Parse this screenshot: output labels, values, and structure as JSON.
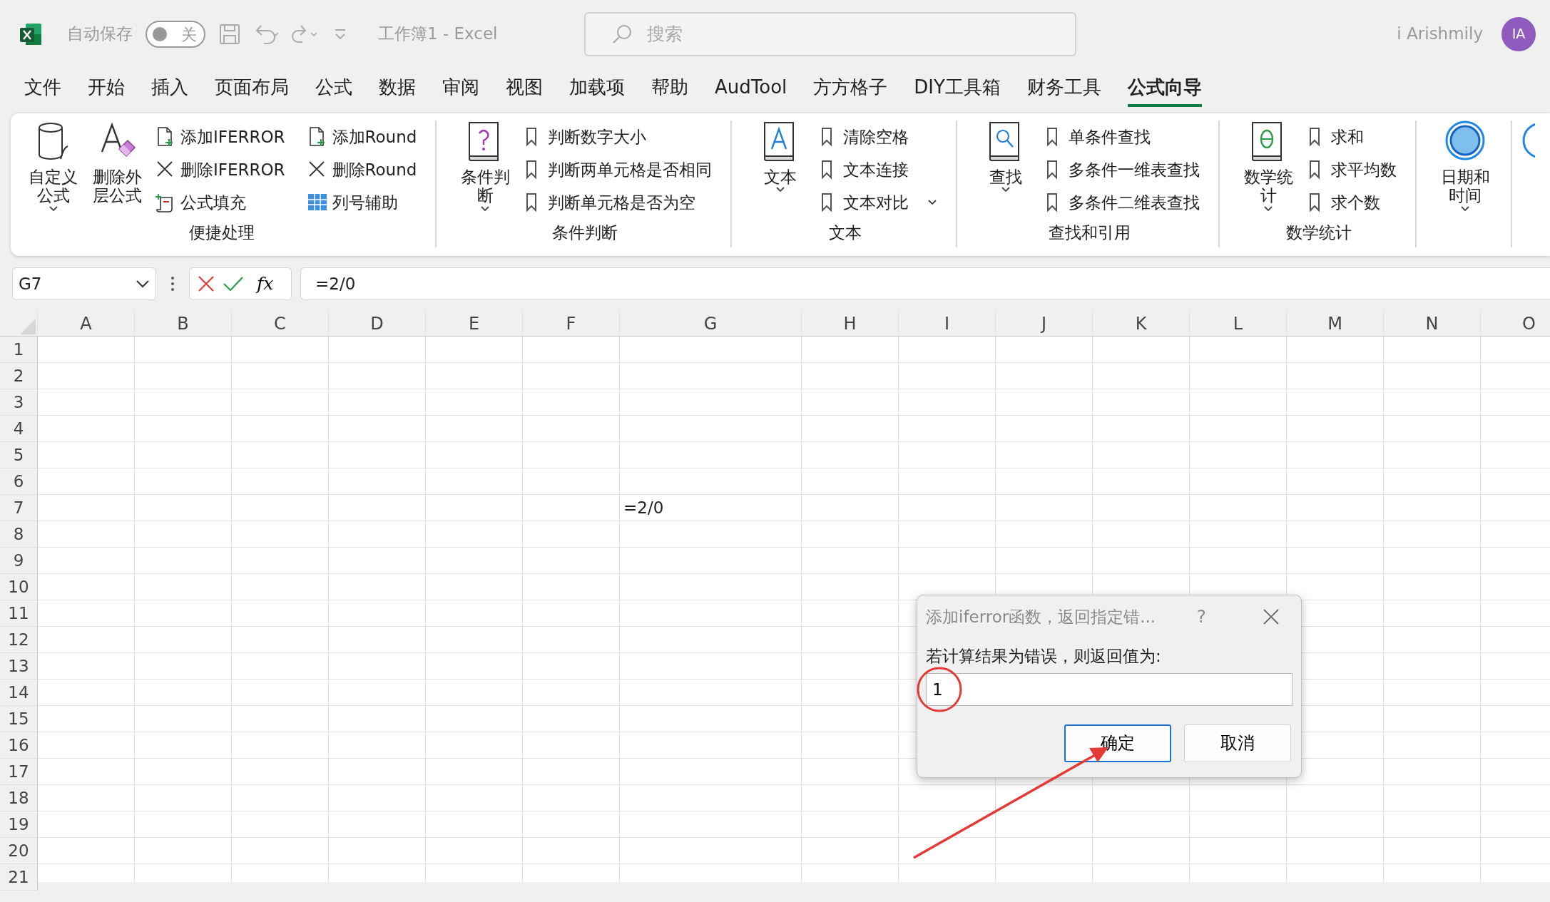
{
  "title_bar": {
    "autosave": {
      "label": "自动保存",
      "on": false,
      "state_label": "关"
    },
    "document_title": "工作簿1  -  Excel",
    "search": {
      "placeholder": "搜索"
    },
    "user_name": "i Arishmily",
    "avatar": "IA"
  },
  "menu_tabs": [
    {
      "label": "文件",
      "selected": false
    },
    {
      "label": "开始",
      "selected": false
    },
    {
      "label": "插入",
      "selected": false
    },
    {
      "label": "页面布局",
      "selected": false
    },
    {
      "label": "公式",
      "selected": false
    },
    {
      "label": "数据",
      "selected": false
    },
    {
      "label": "审阅",
      "selected": false
    },
    {
      "label": "视图",
      "selected": false
    },
    {
      "label": "加载项",
      "selected": false
    },
    {
      "label": "帮助",
      "selected": false
    },
    {
      "label": "AudTool",
      "selected": false
    },
    {
      "label": "方方格子",
      "selected": false
    },
    {
      "label": "DIY工具箱",
      "selected": false
    },
    {
      "label": "财务工具",
      "selected": false
    },
    {
      "label": "公式向导",
      "selected": true
    }
  ],
  "ribbon": {
    "groups": [
      {
        "label": "便捷处理",
        "items": [
          {
            "kind": "large",
            "label": "自定义公式",
            "has_menu": true
          },
          {
            "kind": "large",
            "label": "删除外层公式",
            "has_menu": false
          },
          {
            "kind": "small",
            "label": "添加IFERROR",
            "has_menu": false
          },
          {
            "kind": "small",
            "label": "删除IFERROR",
            "has_menu": false
          },
          {
            "kind": "small",
            "label": "公式填充",
            "has_menu": false
          },
          {
            "kind": "small",
            "label": "添加Round",
            "has_menu": false
          },
          {
            "kind": "small",
            "label": "删除Round",
            "has_menu": false
          },
          {
            "kind": "small",
            "label": "列号辅助",
            "has_menu": false
          }
        ]
      },
      {
        "label": "条件判断",
        "items": [
          {
            "kind": "large",
            "label": "条件判断",
            "has_menu": true
          },
          {
            "kind": "small",
            "label": "判断数字大小",
            "has_menu": false
          },
          {
            "kind": "small",
            "label": "判断两单元格是否相同",
            "has_menu": false
          },
          {
            "kind": "small",
            "label": "判断单元格是否为空",
            "has_menu": false
          }
        ]
      },
      {
        "label": "文本",
        "items": [
          {
            "kind": "large",
            "label": "文本",
            "has_menu": true
          },
          {
            "kind": "small",
            "label": "清除空格",
            "has_menu": false
          },
          {
            "kind": "small",
            "label": "文本连接",
            "has_menu": false
          },
          {
            "kind": "small",
            "label": "文本对比",
            "has_menu": true
          }
        ]
      },
      {
        "label": "查找和引用",
        "items": [
          {
            "kind": "large",
            "label": "查找",
            "has_menu": true
          },
          {
            "kind": "small",
            "label": "单条件查找",
            "has_menu": false
          },
          {
            "kind": "small",
            "label": "多条件一维表查找",
            "has_menu": false
          },
          {
            "kind": "small",
            "label": "多条件二维表查找",
            "has_menu": false
          }
        ]
      },
      {
        "label": "数学统计",
        "items": [
          {
            "kind": "large",
            "label": "数学统计",
            "has_menu": true
          },
          {
            "kind": "small",
            "label": "求和",
            "has_menu": false
          },
          {
            "kind": "small",
            "label": "求平均数",
            "has_menu": false
          },
          {
            "kind": "small",
            "label": "求个数",
            "has_menu": false
          }
        ]
      },
      {
        "items": [
          {
            "kind": "large",
            "label": "日期和时间",
            "has_menu": true
          }
        ]
      }
    ]
  },
  "formula_bar": {
    "name_box": "G7",
    "function_button": "fx",
    "formula": "=2/0"
  },
  "sheet": {
    "columns": [
      "A",
      "B",
      "C",
      "D",
      "E",
      "F",
      "G",
      "H",
      "I",
      "J",
      "K",
      "L",
      "M",
      "N",
      "O"
    ],
    "rows": [
      {
        "header": "1"
      },
      {
        "header": "2"
      },
      {
        "header": "3"
      },
      {
        "header": "4"
      },
      {
        "header": "5"
      },
      {
        "header": "6"
      },
      {
        "header": "7",
        "cells": [
          null,
          null,
          null,
          null,
          null,
          null,
          "=2/0"
        ]
      },
      {
        "header": "8"
      },
      {
        "header": "9"
      },
      {
        "header": "10"
      },
      {
        "header": "11"
      },
      {
        "header": "12"
      },
      {
        "header": "13"
      },
      {
        "header": "14"
      },
      {
        "header": "15"
      },
      {
        "header": "16"
      },
      {
        "header": "17"
      },
      {
        "header": "18"
      },
      {
        "header": "19"
      },
      {
        "header": "20"
      },
      {
        "header": "21"
      }
    ]
  },
  "dialog": {
    "title": "添加iferror函数，返回指定错...",
    "help": "?",
    "prompt": "若计算结果为错误，则返回值为:",
    "value": "1",
    "buttons": [
      {
        "label": "确定",
        "default": true
      },
      {
        "label": "取消",
        "default": false
      }
    ]
  },
  "annotations": {
    "highlight_circle": true,
    "pointer_arrow": true
  }
}
